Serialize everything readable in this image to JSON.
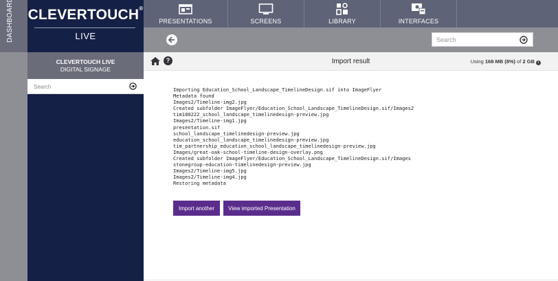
{
  "sidebar_strip": {
    "label": "DASHBOARD"
  },
  "brand": {
    "name": "CLEVERTOUCH",
    "registered": "®",
    "subtitle": "LIVE"
  },
  "nav": {
    "items": [
      {
        "label": "PRESENTATIONS",
        "icon": "presentation-icon"
      },
      {
        "label": "SCREENS",
        "icon": "monitor-icon"
      },
      {
        "label": "LIBRARY",
        "icon": "library-icon"
      },
      {
        "label": "INTERFACES",
        "icon": "interfaces-icon"
      }
    ]
  },
  "toolbar": {
    "search_placeholder": "Search"
  },
  "sidebar": {
    "title": "CLEVERTOUCH LIVE",
    "subtitle": "DIGITAL SIGNAGE",
    "search_placeholder": "Search"
  },
  "content": {
    "title": "Import result",
    "usage": {
      "prefix": "Using ",
      "used": "168 MB (8%)",
      "middle": " of ",
      "total": "2 GB"
    },
    "log_lines": [
      "Importing Education_School_Landscape_TimelineDesign.sif into ImageFlyer",
      "Metadata found",
      "Images2/Timeline-img2.jpg",
      "Created subfolder ImageFlyer/Education_School_Landscape_TimelineDesign.sif/Images2",
      "tim180222_school_landscape_timelinedesign-preview.jpg",
      "Images2/Timeline-img1.jpg",
      "presentation.sif",
      "school_landscape_timelinedesign-preview.jpg",
      "education_school_landscape_timelinedesign-preview.jpg",
      "tim_partnership_education_school_landscape_timelinedesign-preview.jpg",
      "Images/great-oak-school-timeline-design-overlay.png",
      "Created subfolder ImageFlyer/Education_School_Landscape_TimelineDesign.sif/Images",
      "stonegroup-education-timelinedesign-preview.jpg",
      "Images2/Timeline-img5.jpg",
      "Images2/Timeline-img4.jpg",
      "Restoring metadata"
    ],
    "buttons": {
      "import_another": "Import another",
      "view_imported": "View imported Presentation"
    }
  },
  "colors": {
    "navy": "#152046",
    "nav_gray": "#5f6377",
    "purple": "#5a2c8c"
  }
}
